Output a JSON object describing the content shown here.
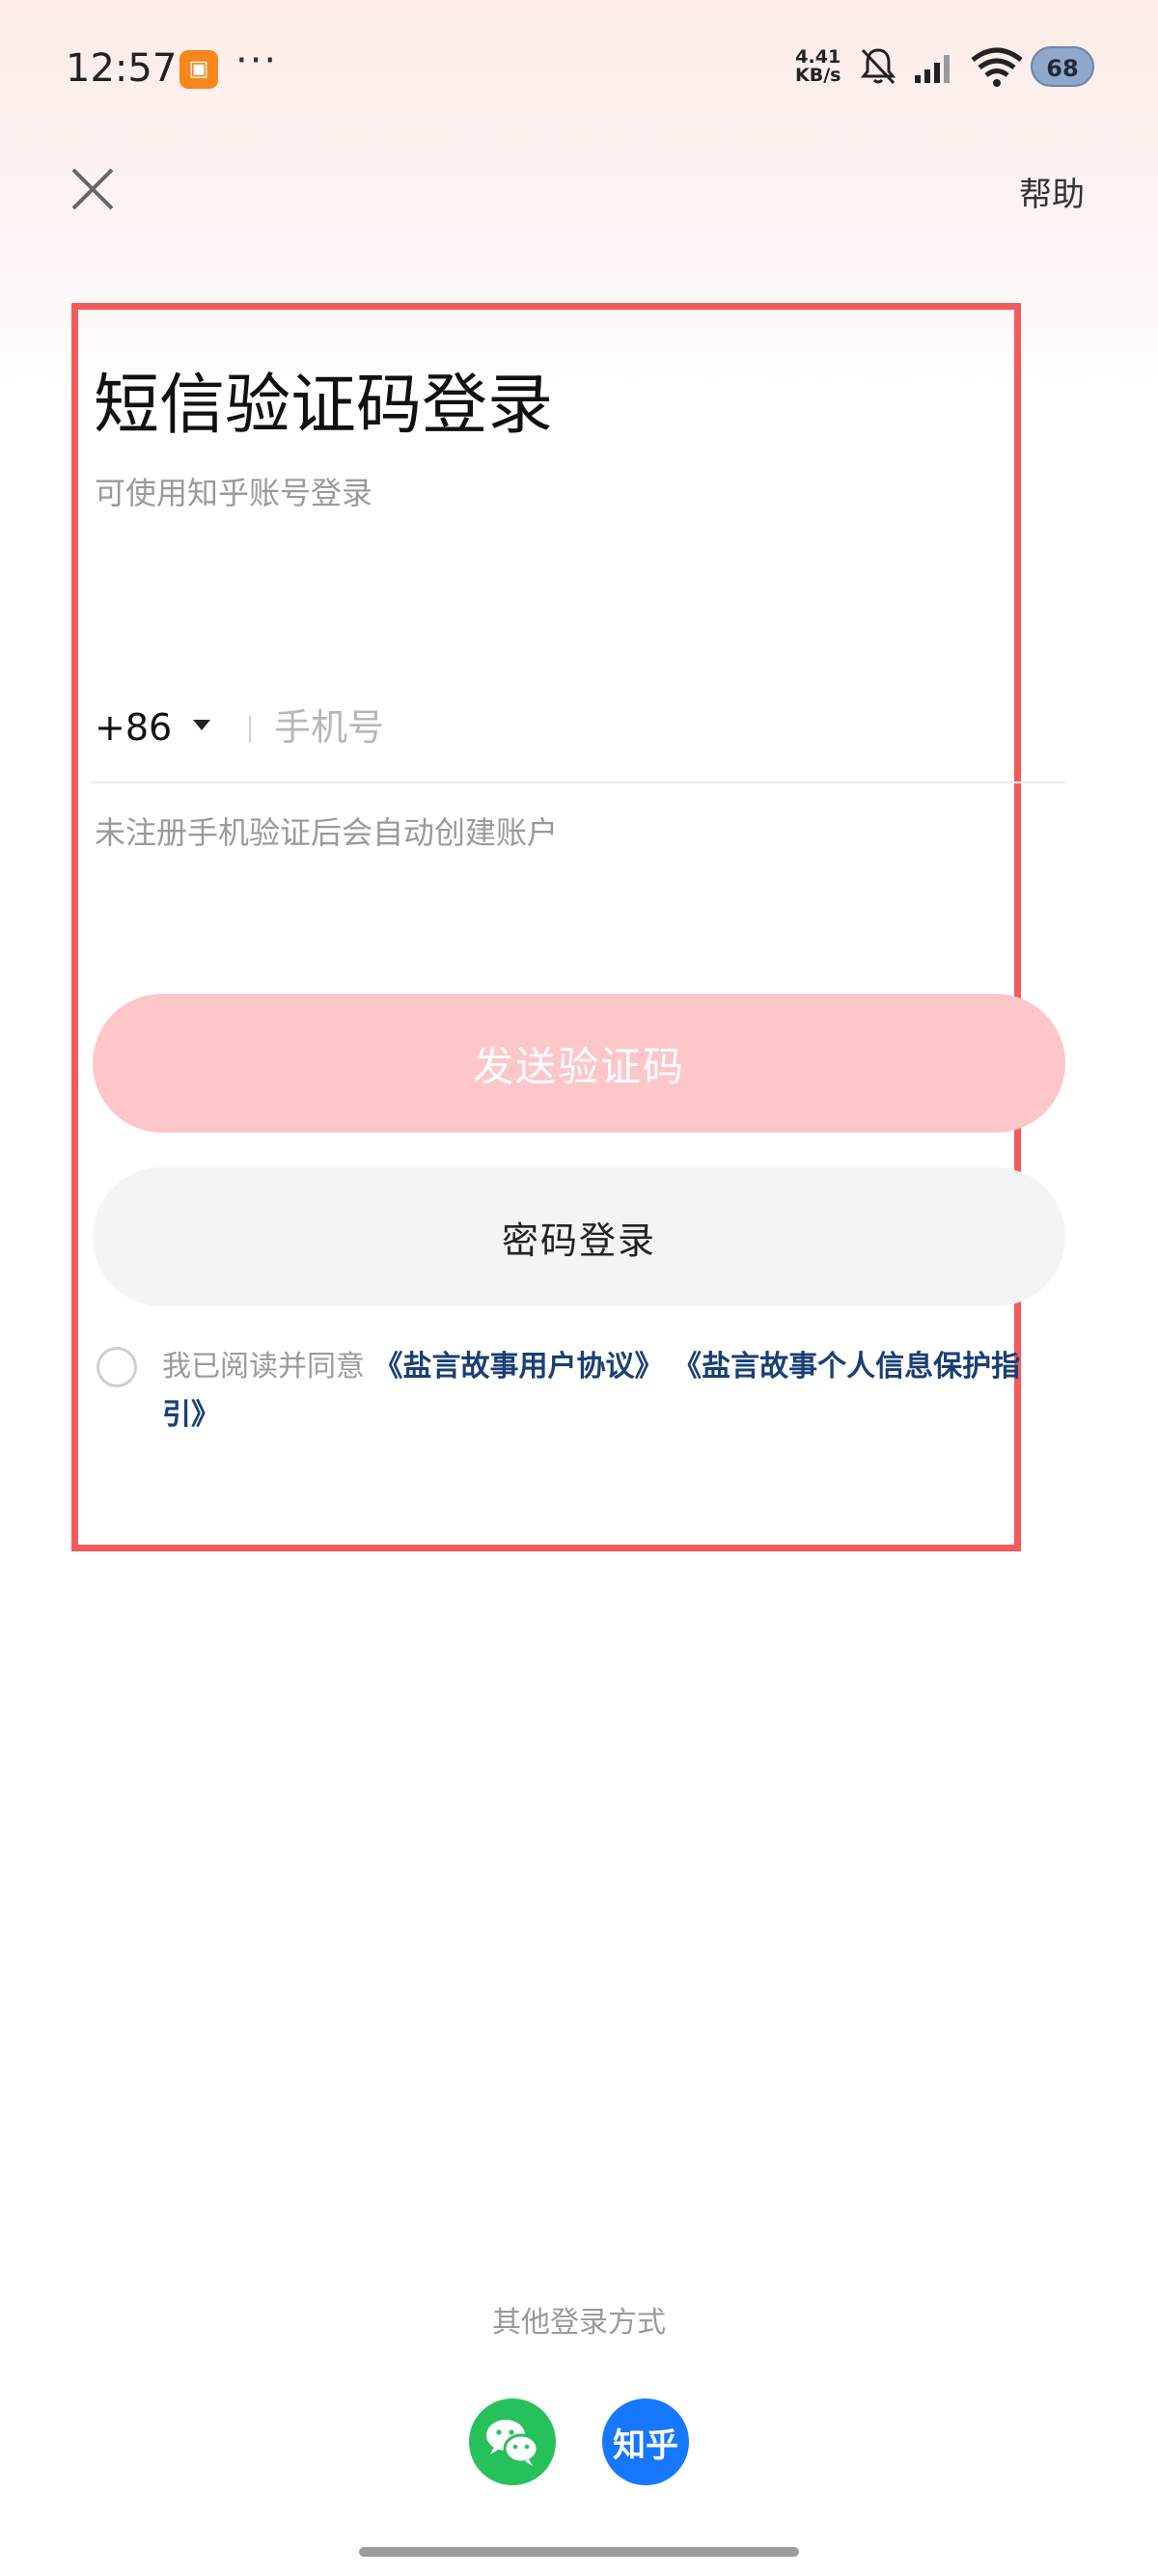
{
  "status_bar": {
    "time": "12:57",
    "net_speed_value": "4.41",
    "net_speed_unit": "KB/s",
    "battery": "68"
  },
  "header": {
    "help_label": "帮助"
  },
  "login": {
    "title": "短信验证码登录",
    "subtitle": "可使用知乎账号登录",
    "country_code": "+86",
    "phone_placeholder": "手机号",
    "hint": "未注册手机验证后会自动创建账户",
    "send_code_label": "发送验证码",
    "password_login_label": "密码登录",
    "agreement_prefix": "我已阅读并同意",
    "agreement_link_1": "《盐言故事用户协议》",
    "agreement_link_2": "《盐言故事个人信息保护指引》"
  },
  "other_login": {
    "label": "其他登录方式",
    "zhihu_label": "知乎"
  },
  "colors": {
    "accent_pink": "#fdc6c8",
    "highlight_frame": "#f45a5a",
    "link_blue": "#1a3f75",
    "wechat_green": "#27c15b",
    "zhihu_blue": "#1677ff"
  },
  "icons": {
    "close": "close-icon",
    "notification_off": "bell-off-icon",
    "signal": "signal-icon",
    "wifi": "wifi-icon",
    "wechat": "wechat-icon",
    "dropdown": "caret-down-icon"
  }
}
